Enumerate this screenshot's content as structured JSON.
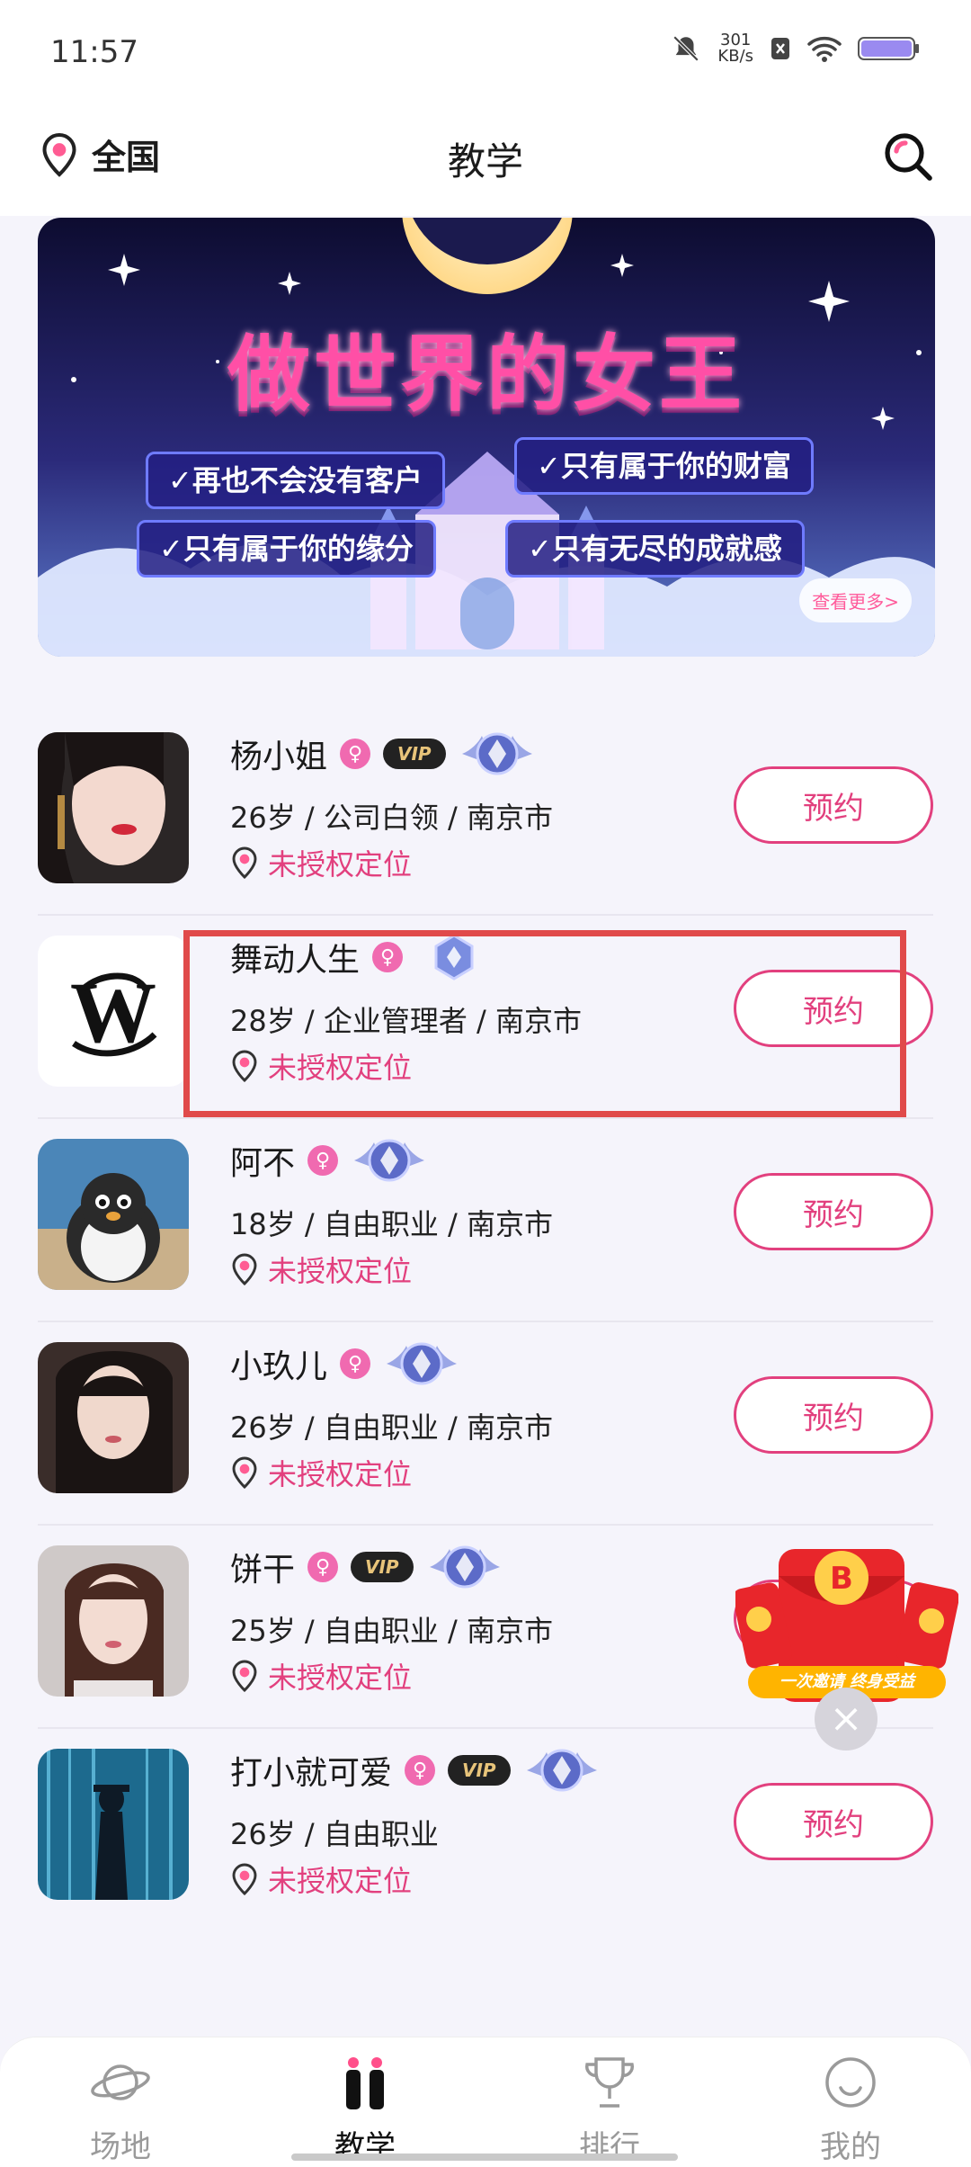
{
  "status_bar": {
    "time": "11:57",
    "net_speed": "301",
    "net_unit": "KB/s"
  },
  "header": {
    "location": "全国",
    "title": "教学"
  },
  "banner": {
    "headline": "做世界的女王",
    "points": [
      "✓再也不会没有客户",
      "✓只有属于你的财富",
      "✓只有属于你的缘分",
      "✓只有无尽的成就感"
    ],
    "more": "查看更多>"
  },
  "list": [
    {
      "name": "杨小姐",
      "vip": "VIP",
      "info": "26岁 / 公司白领 / 南京市",
      "location": "未授权定位",
      "button": "预约"
    },
    {
      "name": "舞动人生",
      "vip": "",
      "info": "28岁 / 企业管理者 / 南京市",
      "location": "未授权定位",
      "button": "预约"
    },
    {
      "name": "阿不",
      "vip": "",
      "info": "18岁 / 自由职业 / 南京市",
      "location": "未授权定位",
      "button": "预约"
    },
    {
      "name": "小玖儿",
      "vip": "",
      "info": "26岁 / 自由职业 / 南京市",
      "location": "未授权定位",
      "button": "预约"
    },
    {
      "name": "饼干",
      "vip": "VIP",
      "info": "25岁 / 自由职业 / 南京市",
      "location": "未授权定位",
      "button": "预约"
    },
    {
      "name": "打小就可爱",
      "vip": "VIP",
      "info": "26岁 / 自由职业",
      "location": "未授权定位",
      "button": "预约"
    }
  ],
  "promo": {
    "text": "一次邀请 终身受益"
  },
  "tabs": [
    {
      "label": "场地",
      "icon": "planet-icon"
    },
    {
      "label": "教学",
      "icon": "teach-icon",
      "active": true
    },
    {
      "label": "排行",
      "icon": "trophy-icon"
    },
    {
      "label": "我的",
      "icon": "smile-icon"
    }
  ]
}
